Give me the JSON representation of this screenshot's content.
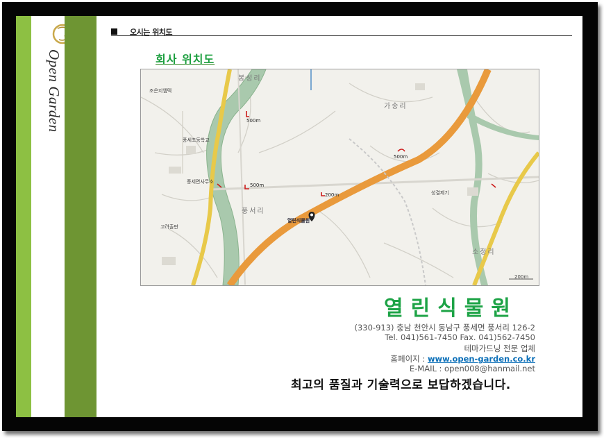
{
  "header": {
    "section_title": "오시는 위치도"
  },
  "sidebar": {
    "logo_text": "Open Garden",
    "logo_mark": "OG"
  },
  "map_section": {
    "subtitle": "회사 위치도",
    "place_labels": {
      "bongsang": "봉성리",
      "gaseong": "가송리",
      "pungseo": "풍서리",
      "sojeong": "소정리",
      "company_marker": "열린식물원",
      "pungse_school": "풍세초등학교",
      "pungse_office": "풍세면사무소",
      "jochun": "조은지엠텍",
      "gorye": "고려출판",
      "sungjae": "성결제기",
      "scale": "200m"
    },
    "distance_labels": [
      "500m",
      "500m",
      "200m",
      "500m"
    ]
  },
  "company": {
    "name": "열린식물원",
    "address": "(330-913) 충남 천안시 동남구 풍세면 풍서리 126-2",
    "phone": "Tel. 041)561-7450    Fax. 041)562-7450",
    "business": "테마가드닝 전문 업체",
    "homepage_label": "홈페이지 : ",
    "homepage_url": "www.open-garden.co.kr",
    "email": "E-MAIL : open008@hanmail.net",
    "slogan": "최고의 품질과 기술력으로 보답하겠습니다."
  },
  "colors": {
    "accent_green": "#1da346",
    "stripe_light": "#8dc043",
    "stripe_dark": "#6e9533",
    "road_orange": "#f0a040",
    "road_yellow": "#f0d060",
    "river": "#a8c8a8"
  }
}
